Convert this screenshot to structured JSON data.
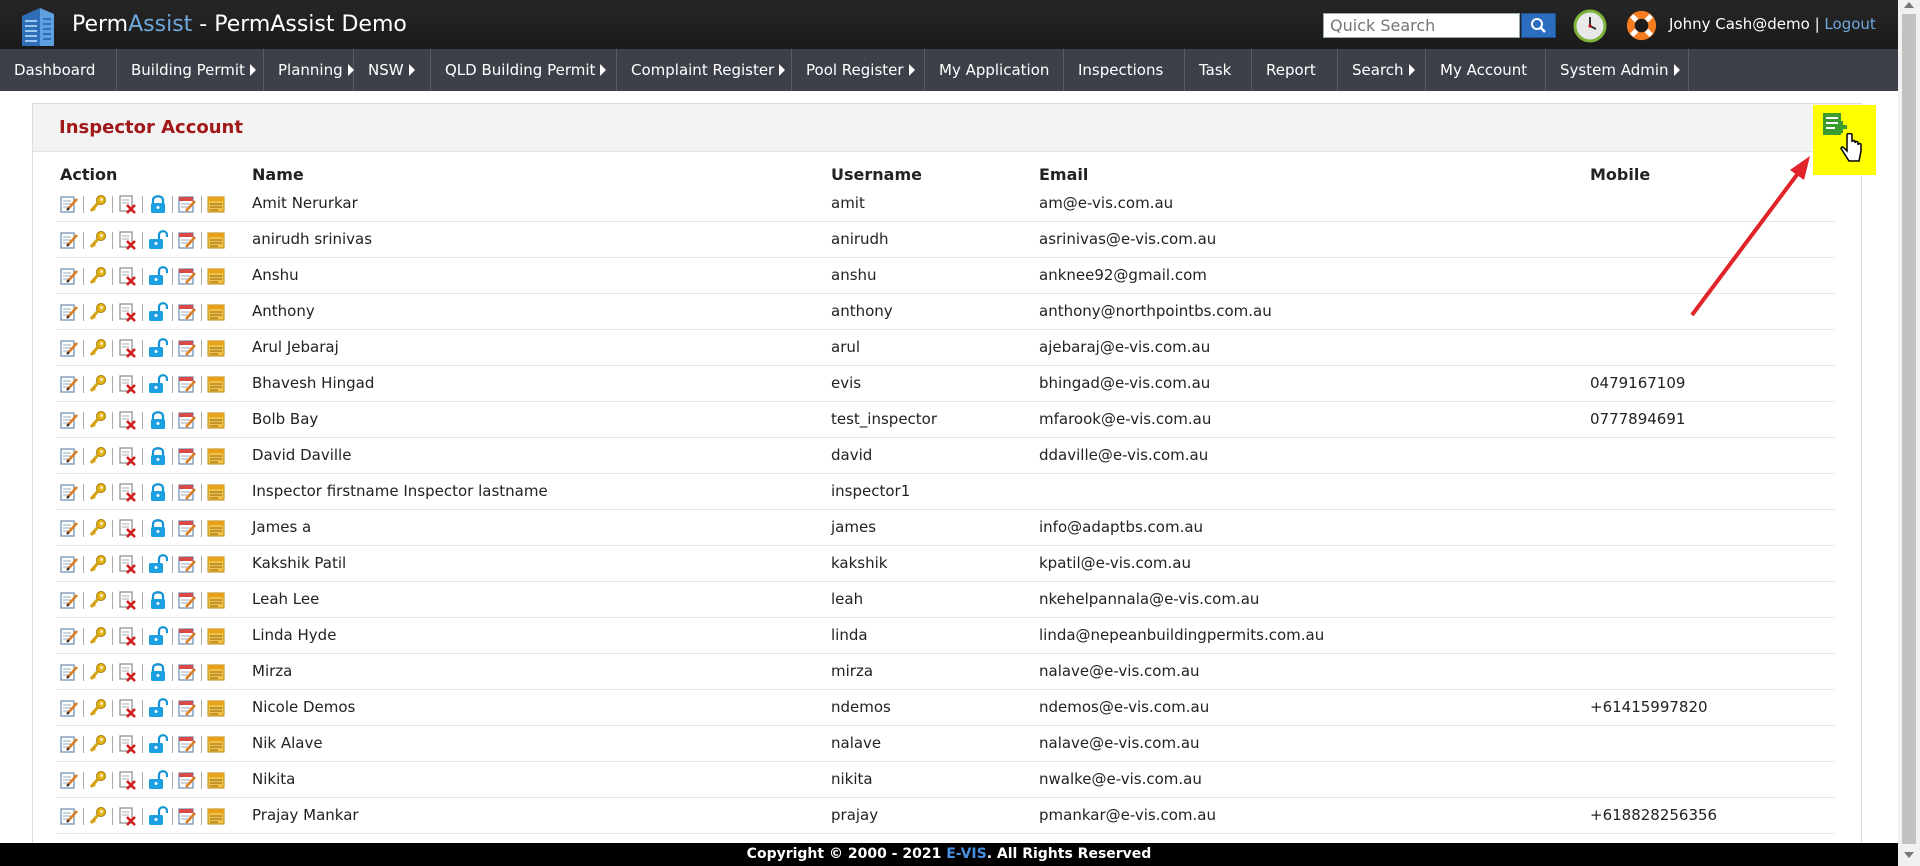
{
  "header": {
    "brand_a": "Perm",
    "brand_b": "Assist",
    "brand_c": " - PermAssist Demo",
    "search_placeholder": "Quick Search",
    "user": "Johny Cash@demo",
    "separator": "|",
    "logout": "Logout"
  },
  "nav": [
    {
      "label": "Dashboard",
      "caret": false
    },
    {
      "label": "Building Permit",
      "caret": true
    },
    {
      "label": "Planning",
      "caret": true
    },
    {
      "label": "NSW",
      "caret": true
    },
    {
      "label": "QLD Building Permit",
      "caret": true
    },
    {
      "label": "Complaint Register",
      "caret": true
    },
    {
      "label": "Pool Register",
      "caret": true
    },
    {
      "label": "My Application",
      "caret": false
    },
    {
      "label": "Inspections",
      "caret": false
    },
    {
      "label": "Task",
      "caret": false
    },
    {
      "label": "Report",
      "caret": false
    },
    {
      "label": "Search",
      "caret": true
    },
    {
      "label": "My Account",
      "caret": false
    },
    {
      "label": "System Admin",
      "caret": true
    }
  ],
  "panel": {
    "title": "Inspector Account"
  },
  "table": {
    "headers": {
      "action": "Action",
      "name": "Name",
      "username": "Username",
      "email": "Email",
      "mobile": "Mobile"
    },
    "rows": [
      {
        "name": "Amit Nerurkar",
        "username": "amit",
        "email": "am@e-vis.com.au",
        "mobile": "",
        "locked": true
      },
      {
        "name": "anirudh srinivas",
        "username": "anirudh",
        "email": "asrinivas@e-vis.com.au",
        "mobile": "",
        "locked": false
      },
      {
        "name": "Anshu",
        "username": "anshu",
        "email": "anknee92@gmail.com",
        "mobile": "",
        "locked": false
      },
      {
        "name": "Anthony",
        "username": "anthony",
        "email": "anthony@northpointbs.com.au",
        "mobile": "",
        "locked": false
      },
      {
        "name": "Arul Jebaraj",
        "username": "arul",
        "email": "ajebaraj@e-vis.com.au",
        "mobile": "",
        "locked": false
      },
      {
        "name": "Bhavesh Hingad",
        "username": "evis",
        "email": "bhingad@e-vis.com.au",
        "mobile": "0479167109",
        "locked": false
      },
      {
        "name": "Bolb Bay",
        "username": "test_inspector",
        "email": "mfarook@e-vis.com.au",
        "mobile": "0777894691",
        "locked": true
      },
      {
        "name": "David Daville",
        "username": "david",
        "email": "ddaville@e-vis.com.au",
        "mobile": "",
        "locked": true
      },
      {
        "name": "Inspector firstname Inspector lastname",
        "username": "inspector1",
        "email": "",
        "mobile": "",
        "locked": true
      },
      {
        "name": "James a",
        "username": "james",
        "email": "info@adaptbs.com.au",
        "mobile": "",
        "locked": true
      },
      {
        "name": "Kakshik Patil",
        "username": "kakshik",
        "email": "kpatil@e-vis.com.au",
        "mobile": "",
        "locked": false
      },
      {
        "name": "Leah Lee",
        "username": "leah",
        "email": "nkehelpannala@e-vis.com.au",
        "mobile": "",
        "locked": true
      },
      {
        "name": "Linda Hyde",
        "username": "linda",
        "email": "linda@nepeanbuildingpermits.com.au",
        "mobile": "",
        "locked": false
      },
      {
        "name": "Mirza",
        "username": "mirza",
        "email": "nalave@e-vis.com.au",
        "mobile": "",
        "locked": true
      },
      {
        "name": "Nicole Demos",
        "username": "ndemos",
        "email": "ndemos@e-vis.com.au",
        "mobile": "+61415997820",
        "locked": false
      },
      {
        "name": "Nik Alave",
        "username": "nalave",
        "email": "nalave@e-vis.com.au",
        "mobile": "",
        "locked": false
      },
      {
        "name": "Nikita",
        "username": "nikita",
        "email": "nwalke@e-vis.com.au",
        "mobile": "",
        "locked": false
      },
      {
        "name": "Prajay Mankar",
        "username": "prajay",
        "email": "pmankar@e-vis.com.au",
        "mobile": "+618828256356",
        "locked": false
      }
    ]
  },
  "footer": {
    "prefix": "Copyright © 2000 - 2021 ",
    "company": "E-VIS",
    "suffix": ". All Rights Reserved"
  },
  "colors": {
    "title_red": "#a01818",
    "nav_bg": "#3d4049",
    "highlight": "#ffff00",
    "arrow": "#e0242a",
    "link_blue": "#6fa8dc"
  },
  "icons": [
    "buildings-logo-icon",
    "search-icon",
    "clock-icon",
    "lifebuoy-icon",
    "edit-icon",
    "key-icon",
    "delete-icon",
    "lock-icon",
    "unlock-icon",
    "edit-calendar-icon",
    "notes-icon",
    "add-document-icon",
    "hand-cursor-icon"
  ]
}
